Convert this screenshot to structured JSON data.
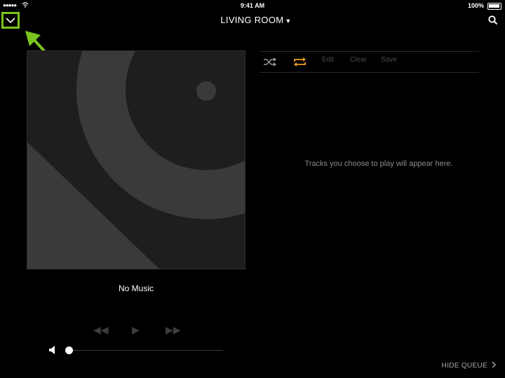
{
  "status": {
    "time": "9:41 AM",
    "battery": "100%"
  },
  "header": {
    "room": "LIVING ROOM"
  },
  "now_playing": {
    "title": "No Music"
  },
  "volume": {
    "level": 0.0
  },
  "queue": {
    "edit_label": "Edit",
    "clear_label": "Clear",
    "save_label": "Save",
    "empty_message": "Tracks you choose to play will appear here."
  },
  "footer": {
    "hide_queue_label": "HIDE QUEUE"
  },
  "colors": {
    "highlight": "#7bc41f",
    "repeat_active": "#f29f2c",
    "background": "#000000"
  },
  "icons": [
    "chevron-down-icon",
    "caret-down-icon",
    "search-icon",
    "shuffle-icon",
    "repeat-icon",
    "previous-icon",
    "play-icon",
    "next-icon",
    "speaker-icon",
    "chevron-right-icon",
    "annotation-arrow"
  ]
}
